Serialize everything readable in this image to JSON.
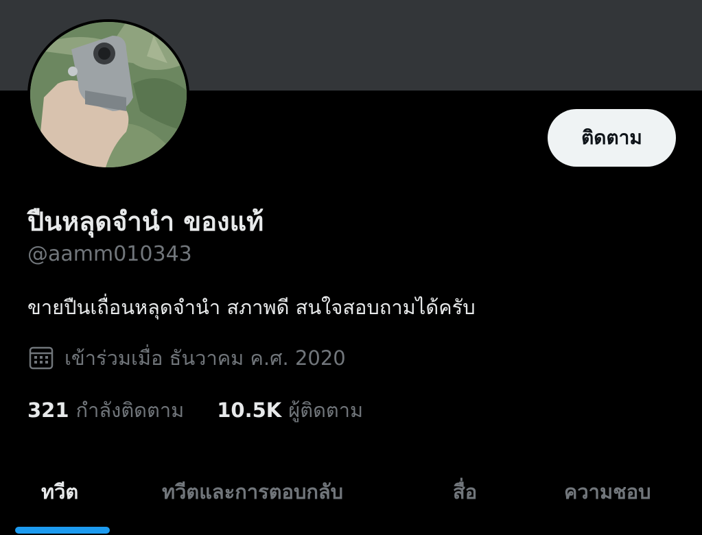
{
  "profile": {
    "display_name": "ปืนหลุดจำนำ ของแท้",
    "handle": "@aamm010343",
    "bio": "ขายปืนเถื่อนหลุดจำนำ สภาพดี สนใจสอบถามได้ครับ",
    "joined": "เข้าร่วมเมื่อ ธันวาคม ค.ศ. 2020",
    "following_count": "321",
    "following_label": "กำลังติดตาม",
    "followers_count": "10.5K",
    "followers_label": "ผู้ติดตาม"
  },
  "actions": {
    "follow_label": "ติดตาม"
  },
  "tabs": [
    {
      "label": "ทวีต",
      "active": true
    },
    {
      "label": "ทวีตและการตอบกลับ",
      "active": false
    },
    {
      "label": "สื่อ",
      "active": false
    },
    {
      "label": "ความชอบ",
      "active": false
    }
  ],
  "icons": {
    "joined": "calendar-icon"
  },
  "colors": {
    "background": "#000000",
    "banner": "#333639",
    "primary_text": "#e7e9ea",
    "secondary_text": "#71767b",
    "accent": "#1d9bf0",
    "button_bg": "#eff3f4"
  }
}
